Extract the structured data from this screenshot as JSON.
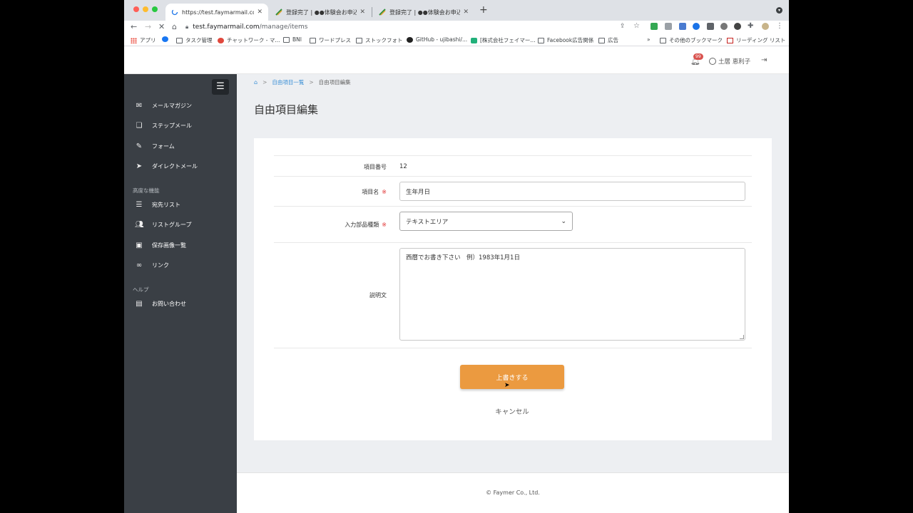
{
  "browser": {
    "tabs": [
      {
        "title": "https://test.faymarmail.com/m..."
      },
      {
        "title": "登録完了 | ●●体験会お申込みフ..."
      },
      {
        "title": "登録完了 | ●●体験会お申込みフ..."
      }
    ],
    "url_host": "test.faymarmail.com",
    "url_path": "/manage/items",
    "bookmarks": [
      "アプリ",
      "",
      "タスク管理",
      "チャットワーク - マ...",
      "BNI",
      "ワードプレス",
      "ストックフォト",
      "GitHub - ujibashi/...",
      "[株式会社フェイマー...",
      "Facebook広告関係",
      "広告",
      "»",
      "その他のブックマーク",
      "リーディング リスト"
    ]
  },
  "header": {
    "notification_count": "99",
    "user_name": "土居 恵利子"
  },
  "sidebar": {
    "items": [
      {
        "label": "メールマガジン"
      },
      {
        "label": "ステップメール"
      },
      {
        "label": "フォーム"
      },
      {
        "label": "ダイレクトメール"
      }
    ],
    "section_advanced": "高度な機能",
    "advanced_items": [
      {
        "label": "宛先リスト"
      },
      {
        "label": "リストグループ"
      },
      {
        "label": "保存画像一覧"
      },
      {
        "label": "リンク"
      }
    ],
    "section_help": "ヘルプ",
    "help_items": [
      {
        "label": "お問い合わせ"
      }
    ]
  },
  "breadcrumb": {
    "sep": ">",
    "parent": "自由項目一覧",
    "current": "自由項目編集"
  },
  "page": {
    "title": "自由項目編集"
  },
  "form": {
    "item_number_label": "項目番号",
    "item_number_value": "12",
    "item_name_label": "項目名",
    "item_name_value": "生年月日",
    "required_mark": "※",
    "input_type_label": "入力部品種類",
    "input_type_value": "テキストエリア",
    "description_label": "説明文",
    "description_value": "西暦でお書き下さい　例）1983年1月1日",
    "submit_label": "上書きする",
    "cancel_label": "キャンセル"
  },
  "footer": {
    "copyright": "© Faymer Co., Ltd."
  },
  "colors": {
    "sidebar_bg": "#3a3f45",
    "accent_button": "#eb9a40",
    "link": "#3a8fd6",
    "required": "#e03030"
  }
}
